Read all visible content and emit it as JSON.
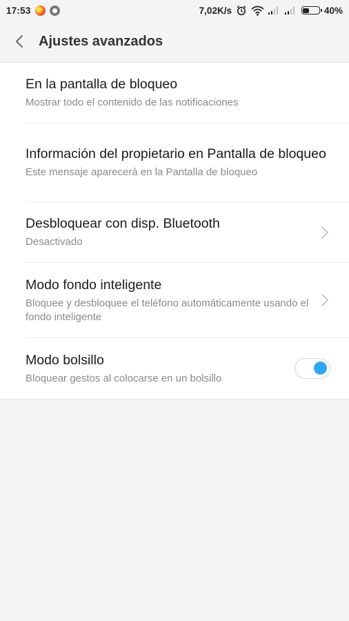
{
  "status_bar": {
    "time": "17:53",
    "net_speed": "7,02K/s",
    "battery": "40%",
    "battery_level": 0.4,
    "icons": [
      "firefox-icon",
      "whatsapp-icon",
      "alarm-icon",
      "wifi-icon",
      "signal-icon",
      "signal-icon",
      "battery-icon"
    ]
  },
  "header": {
    "title": "Ajustes avanzados",
    "back_icon": "chevron-left-icon"
  },
  "items": [
    {
      "title": "En la pantalla de bloqueo",
      "subtitle": "Mostrar todo el contenido de las notificaciones",
      "control": "none"
    },
    {
      "title": "Información del propietario en Pantalla de bloqueo",
      "subtitle": "Este mensaje aparecerá en la Pantalla de bloqueo",
      "control": "none"
    },
    {
      "title": "Desbloquear con disp. Bluetooth",
      "subtitle": "Desactivado",
      "control": "chevron-right-icon"
    },
    {
      "title": "Modo fondo inteligente",
      "subtitle": "Bloquee y desbloquee el teléfono automáticamente usando el fondo inteligente",
      "control": "chevron-right-icon"
    },
    {
      "title": "Modo bolsillo",
      "subtitle": "Bloquear gestos al colocarse en un bolsillo",
      "control": "toggle",
      "toggle_on": true
    }
  ],
  "colors": {
    "accent": "#2ea8f5",
    "background": "#f4f4f4",
    "list_background": "#ffffff",
    "subtitle": "#8a8a8a"
  }
}
